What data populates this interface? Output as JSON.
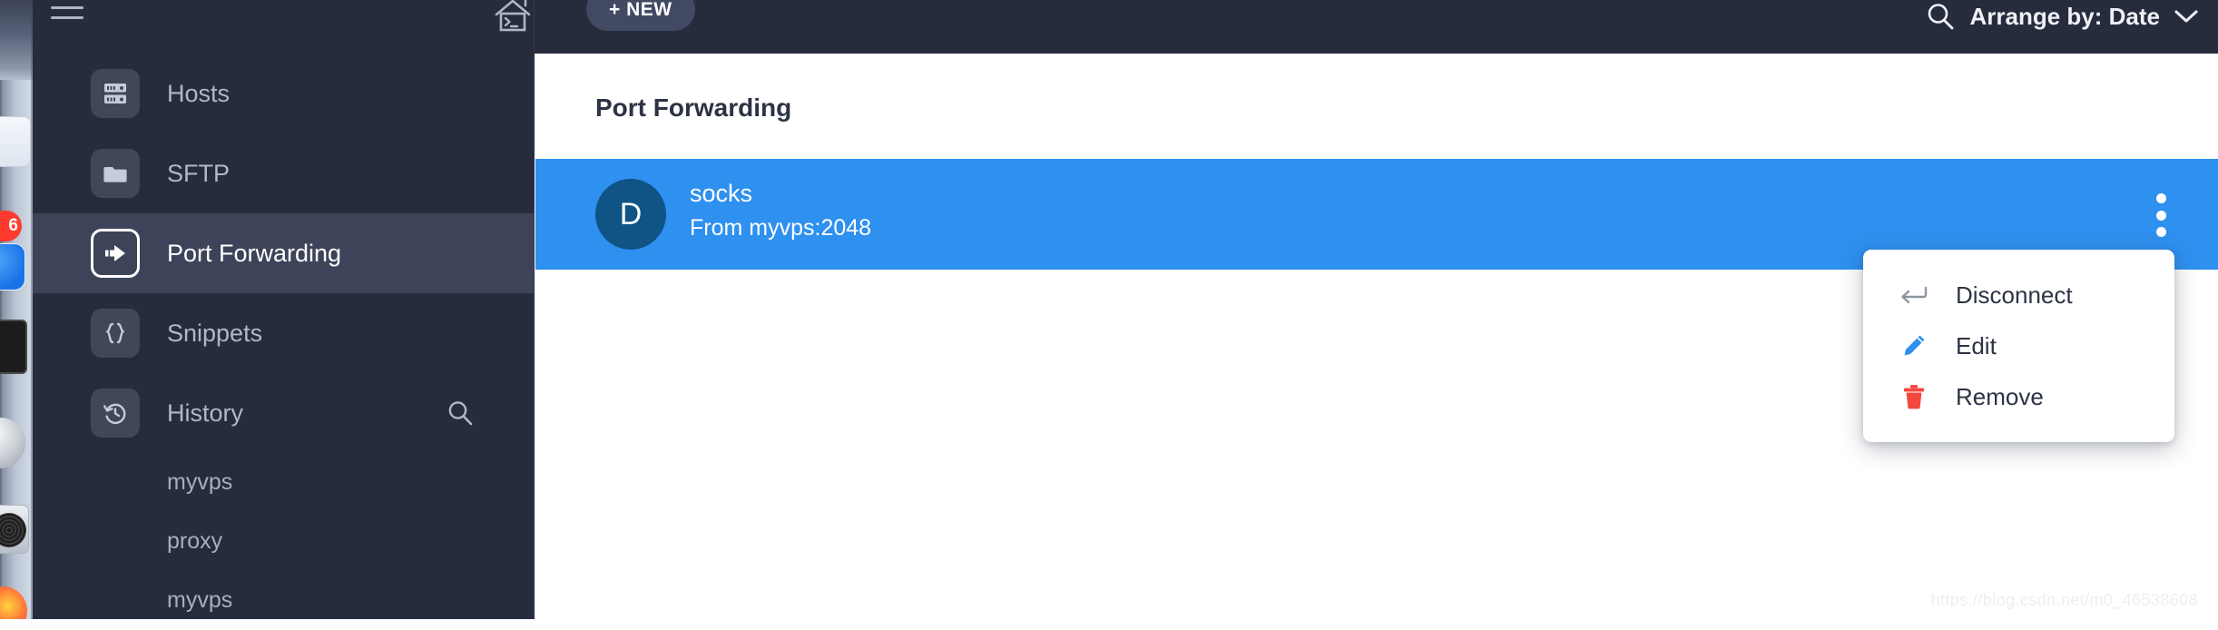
{
  "window": {
    "top_bar": {
      "hamburger_icon": "hamburger-menu-icon",
      "home_icon": "home-terminal-icon",
      "new_button_label": "+ NEW",
      "search_icon": "search-icon",
      "arrange_label": "Arrange by: Date",
      "caret_icon": "chevron-down-icon"
    },
    "sidebar": {
      "items": [
        {
          "label": "Hosts",
          "icon": "server-rack-icon",
          "active": false
        },
        {
          "label": "SFTP",
          "icon": "folder-icon",
          "active": false
        },
        {
          "label": "Port Forwarding",
          "icon": "arrow-forward-icon",
          "active": true
        },
        {
          "label": "Snippets",
          "icon": "curly-braces-icon",
          "active": false
        },
        {
          "label": "History",
          "icon": "clock-rewind-icon",
          "active": false
        }
      ],
      "history_search_icon": "search-icon",
      "history_entries": [
        {
          "label": "myvps"
        },
        {
          "label": "proxy"
        },
        {
          "label": "myvps"
        }
      ]
    },
    "main": {
      "page_title": "Port Forwarding",
      "session": {
        "avatar_letter": "D",
        "name": "socks",
        "subtitle": "From myvps:2048",
        "kebab_icon": "more-vertical-icon"
      },
      "context_menu": {
        "items": [
          {
            "label": "Disconnect",
            "icon": "disconnect-arrow-icon",
            "color": "#8d94a3"
          },
          {
            "label": "Edit",
            "icon": "pencil-icon",
            "color": "#2e90ef"
          },
          {
            "label": "Remove",
            "icon": "trash-icon",
            "color": "#f4483f"
          }
        ]
      }
    },
    "watermark": "https://blog.csdn.net/m0_46538608"
  },
  "dock": {
    "badge_count": "6"
  },
  "colors": {
    "chrome_dark": "#272c3d",
    "sidebar_active": "#3d4459",
    "accent_blue": "#2e90ef",
    "avatar_blue": "#0f5485",
    "danger_red": "#f4483f",
    "content_bg": "#ffffff"
  }
}
